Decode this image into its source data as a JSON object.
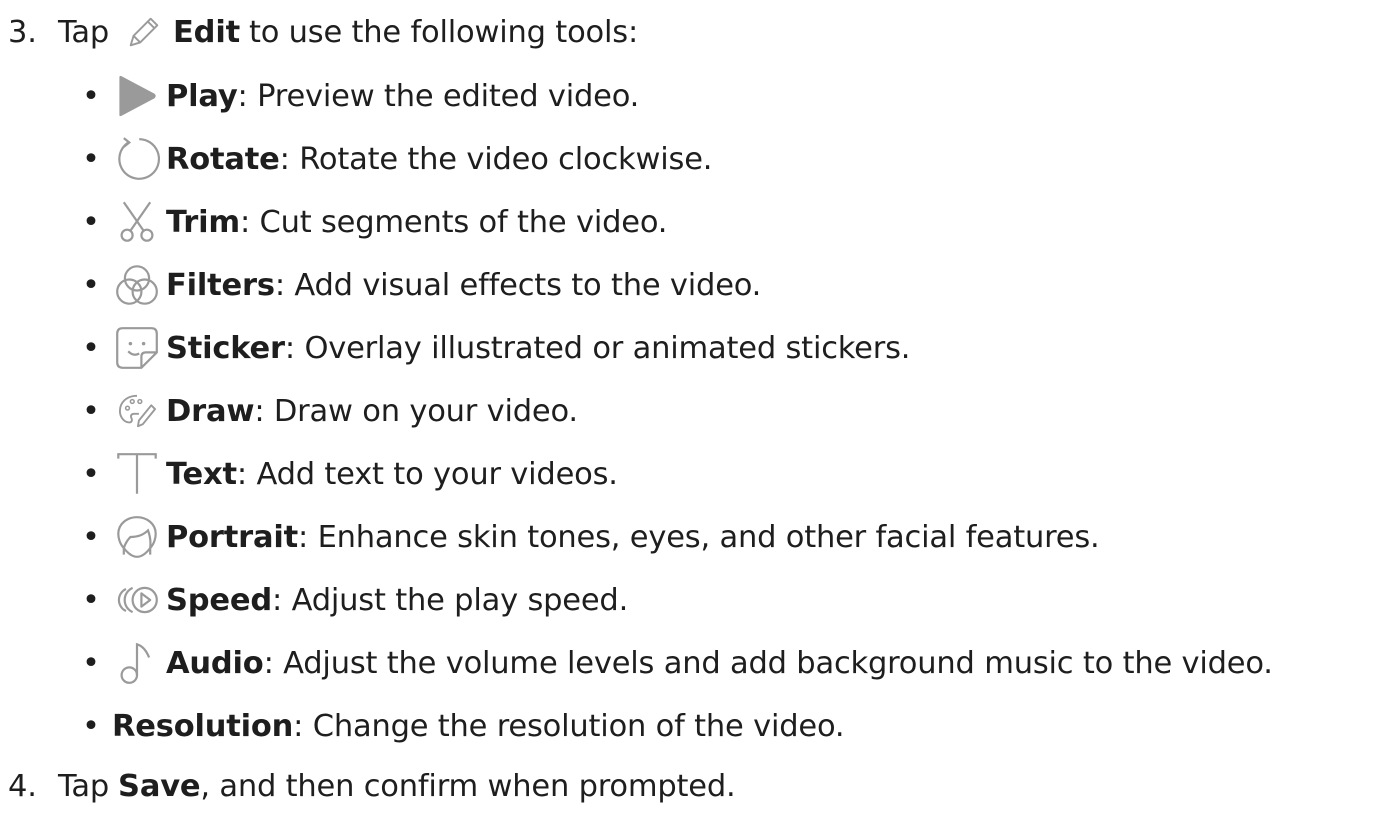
{
  "steps": [
    {
      "number": "3.",
      "prefix": "Tap",
      "icon": "pencil-icon",
      "bold": "Edit",
      "rest": "to use the following tools:"
    },
    {
      "number": "4.",
      "prefix": "Tap",
      "bold": "Save",
      "rest": ", and then confirm when prompted."
    }
  ],
  "tools": [
    {
      "icon": "play-icon",
      "name": "Play",
      "desc": ": Preview the edited video."
    },
    {
      "icon": "rotate-icon",
      "name": "Rotate",
      "desc": ": Rotate the video clockwise."
    },
    {
      "icon": "scissors-icon",
      "name": "Trim",
      "desc": ": Cut segments of the video."
    },
    {
      "icon": "filters-icon",
      "name": "Filters",
      "desc": ": Add visual effects to the video."
    },
    {
      "icon": "sticker-icon",
      "name": "Sticker",
      "desc": ": Overlay illustrated or animated stickers."
    },
    {
      "icon": "palette-icon",
      "name": "Draw",
      "desc": ": Draw on your video."
    },
    {
      "icon": "text-icon",
      "name": "Text",
      "desc": ": Add text to your videos."
    },
    {
      "icon": "portrait-icon",
      "name": "Portrait",
      "desc": ": Enhance skin tones, eyes, and other facial features."
    },
    {
      "icon": "speed-icon",
      "name": "Speed",
      "desc": ": Adjust the play speed."
    },
    {
      "icon": "music-note-icon",
      "name": "Audio",
      "desc": ": Adjust the volume levels and add background music to the video."
    },
    {
      "name": "Resolution",
      "desc": ": Change the resolution of the video."
    }
  ],
  "colors": {
    "text": "#1e1e1e",
    "icon": "#9a9a9a"
  }
}
